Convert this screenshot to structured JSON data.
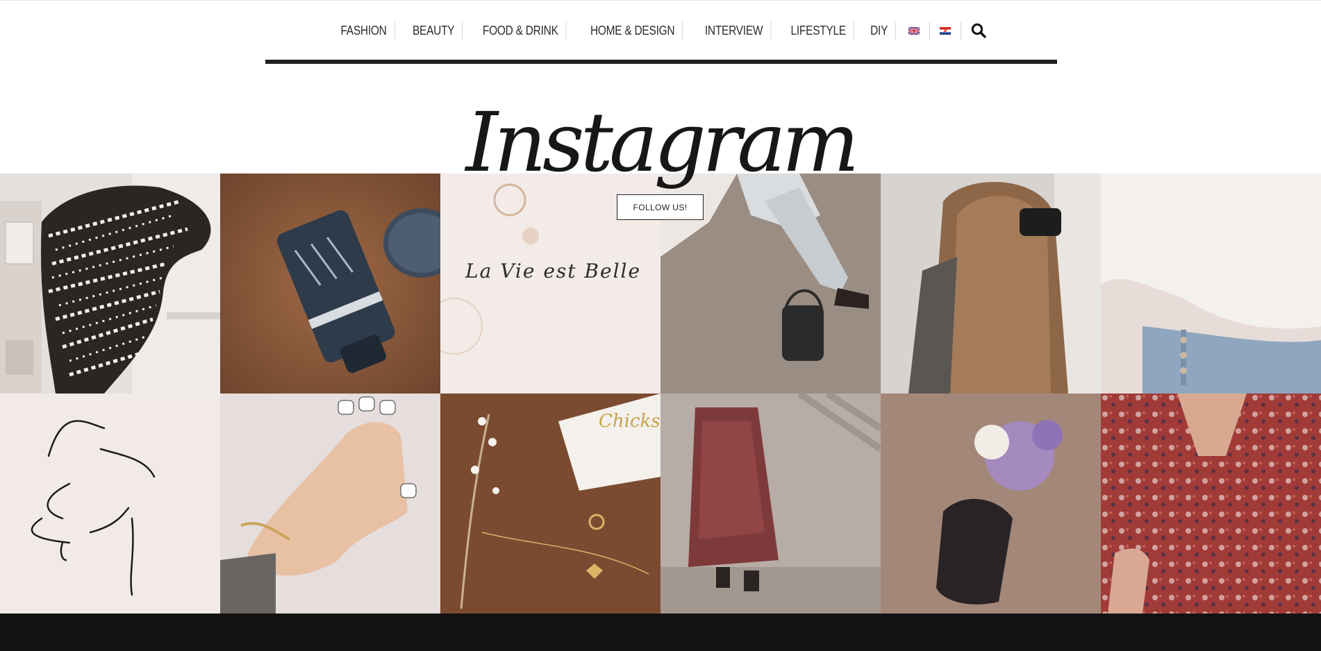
{
  "nav": {
    "items": [
      {
        "label": "FASHION"
      },
      {
        "label": "BEAUTY"
      },
      {
        "label": "FOOD & DRINK"
      },
      {
        "label": "HOME & DESIGN"
      },
      {
        "label": "INTERVIEW"
      },
      {
        "label": "LIFESTYLE"
      },
      {
        "label": "DIY"
      }
    ],
    "flags": [
      {
        "icon": "uk-flag-icon"
      },
      {
        "icon": "croatia-flag-icon"
      }
    ],
    "search_icon": "search-icon"
  },
  "section": {
    "title": "Instagram",
    "follow_label": "FOLLOW US!"
  },
  "grid": {
    "tiles": [
      {
        "label": "La Vie est Belle"
      },
      {
        "label": "Chicks"
      }
    ]
  }
}
